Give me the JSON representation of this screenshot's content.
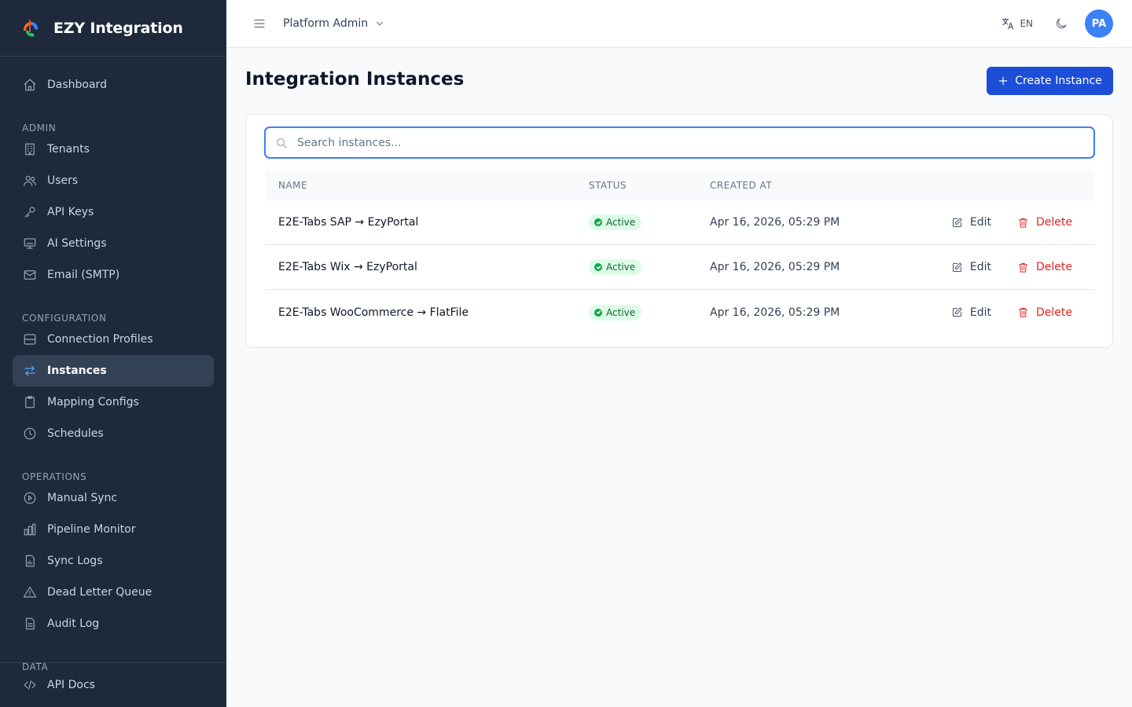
{
  "app": {
    "name": "EZY Integration"
  },
  "colors": {
    "sidebar_bg": "#1e293b",
    "accent": "#1d4ed8",
    "active_icon": "#60a5fa",
    "status_active": "#16a34a",
    "danger": "#dc2626"
  },
  "sidebar": {
    "dashboard": {
      "label": "Dashboard",
      "icon": "home-icon"
    },
    "sections": [
      {
        "label": "ADMIN",
        "items": [
          {
            "label": "Tenants",
            "icon": "building-icon"
          },
          {
            "label": "Users",
            "icon": "users-icon"
          },
          {
            "label": "API Keys",
            "icon": "key-icon"
          },
          {
            "label": "AI Settings",
            "icon": "monitor-icon"
          },
          {
            "label": "Email (SMTP)",
            "icon": "mail-icon"
          }
        ]
      },
      {
        "label": "CONFIGURATION",
        "items": [
          {
            "label": "Connection Profiles",
            "icon": "database-icon"
          },
          {
            "label": "Instances",
            "icon": "arrows-swap-icon",
            "active": true
          },
          {
            "label": "Mapping Configs",
            "icon": "clipboard-icon"
          },
          {
            "label": "Schedules",
            "icon": "clock-icon"
          }
        ]
      },
      {
        "label": "OPERATIONS",
        "items": [
          {
            "label": "Manual Sync",
            "icon": "play-circle-icon"
          },
          {
            "label": "Pipeline Monitor",
            "icon": "bar-chart-icon"
          },
          {
            "label": "Sync Logs",
            "icon": "file-chart-icon"
          },
          {
            "label": "Dead Letter Queue",
            "icon": "warning-icon"
          },
          {
            "label": "Audit Log",
            "icon": "file-text-icon"
          }
        ]
      },
      {
        "label": "DATA",
        "items": []
      }
    ],
    "bottom": {
      "label": "API Docs",
      "icon": "code-icon"
    }
  },
  "topbar": {
    "tenant": "Platform Admin",
    "language": "EN",
    "avatar_initials": "PA"
  },
  "page": {
    "title": "Integration Instances",
    "create_label": "Create Instance",
    "search_placeholder": "Search instances..."
  },
  "table": {
    "columns": [
      "NAME",
      "STATUS",
      "CREATED AT"
    ],
    "edit_label": "Edit",
    "delete_label": "Delete",
    "rows": [
      {
        "name": "E2E-Tabs SAP → EzyPortal",
        "status": "Active",
        "created": "Apr 16, 2026, 05:29 PM"
      },
      {
        "name": "E2E-Tabs Wix → EzyPortal",
        "status": "Active",
        "created": "Apr 16, 2026, 05:29 PM"
      },
      {
        "name": "E2E-Tabs WooCommerce → FlatFile",
        "status": "Active",
        "created": "Apr 16, 2026, 05:29 PM"
      }
    ]
  }
}
